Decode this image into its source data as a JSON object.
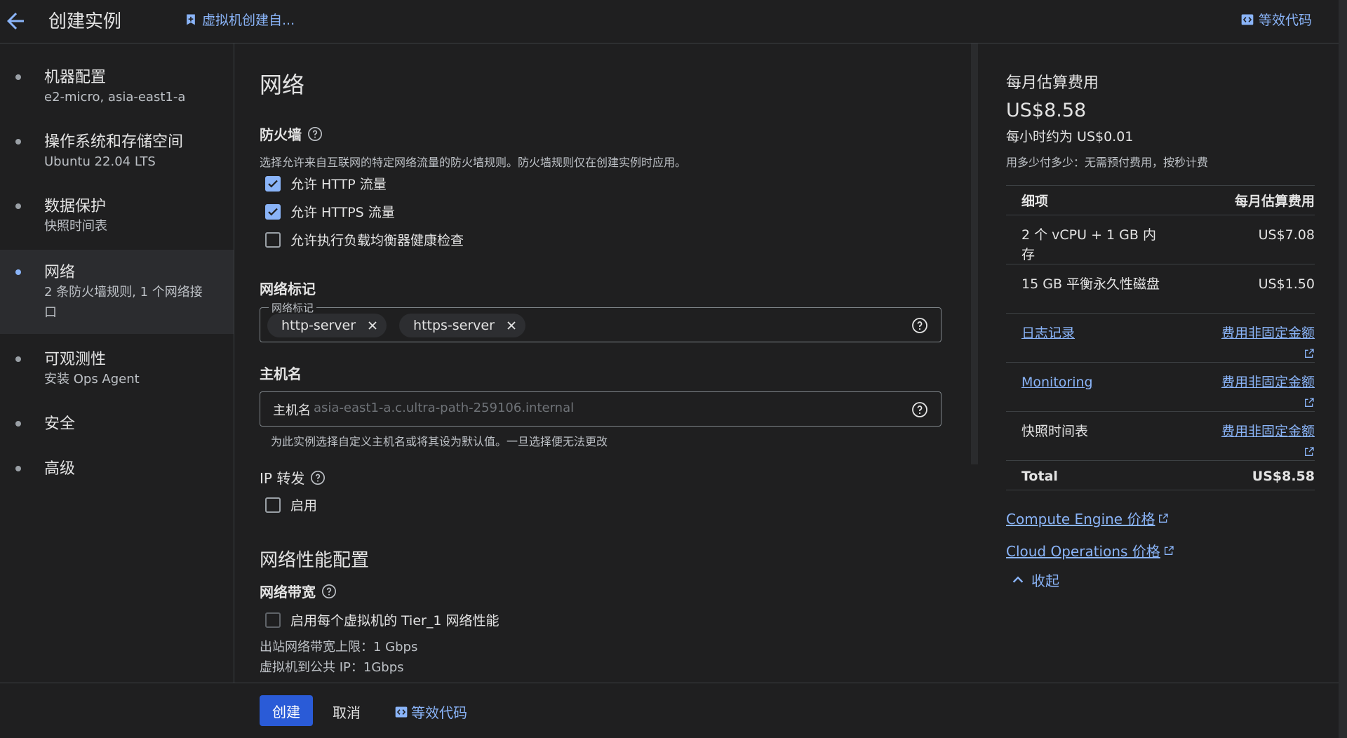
{
  "header": {
    "title": "创建实例",
    "vm_link": "虚拟机创建自...",
    "equiv_code": "等效代码"
  },
  "sidebar": {
    "items": [
      {
        "label": "机器配置",
        "sub": "e2-micro, asia-east1-a"
      },
      {
        "label": "操作系统和存储空间",
        "sub": "Ubuntu 22.04 LTS"
      },
      {
        "label": "数据保护",
        "sub": "快照时间表"
      },
      {
        "label": "网络",
        "sub": "2 条防火墙规则, 1 个网络接口",
        "active": true
      },
      {
        "label": "可观测性",
        "sub": "安装 Ops Agent"
      },
      {
        "label": "安全",
        "sub": ""
      },
      {
        "label": "高级",
        "sub": ""
      }
    ]
  },
  "network": {
    "title": "网络",
    "firewall": {
      "title": "防火墙",
      "desc": "选择允许来自互联网的特定网络流量的防火墙规则。防火墙规则仅在创建实例时应用。",
      "options": [
        {
          "label": "允许 HTTP 流量",
          "checked": true
        },
        {
          "label": "允许 HTTPS 流量",
          "checked": true
        },
        {
          "label": "允许执行负载均衡器健康检查",
          "checked": false
        }
      ]
    },
    "tags": {
      "title": "网络标记",
      "legend": "网络标记",
      "chips": [
        "http-server",
        "https-server"
      ]
    },
    "hostname": {
      "title": "主机名",
      "label": "主机名",
      "placeholder": "asia-east1-a.c.ultra-path-259106.internal",
      "hint": "为此实例选择自定义主机名或将其设为默认值。一旦选择便无法更改"
    },
    "ip_forwarding": {
      "title": "IP 转发",
      "option": "启用"
    },
    "performance": {
      "title": "网络性能配置",
      "bandwidth_title": "网络带宽",
      "option": "启用每个虚拟机的 Tier_1 网络性能",
      "egress": "出站网络带宽上限：1 Gbps",
      "public_ip": "虚拟机到公共 IP：1Gbps"
    }
  },
  "footer": {
    "create": "创建",
    "cancel": "取消",
    "equiv_code": "等效代码"
  },
  "cost": {
    "title": "每月估算费用",
    "amount": "US$8.58",
    "hourly": "每小时约为 US$0.01",
    "note": "用多少付多少：无需预付费用，按秒计费",
    "header": {
      "item": "细项",
      "price": "每月估算费用"
    },
    "rows": [
      {
        "item": "2 个 vCPU + 1 GB 内存",
        "price": "US$7.08",
        "item_link": false,
        "price_link": false
      },
      {
        "item": "15 GB 平衡永久性磁盘",
        "price": "US$1.50",
        "item_link": false,
        "price_link": false
      },
      {
        "item": "日志记录",
        "price": "费用非固定金额",
        "item_link": true,
        "price_link": true
      },
      {
        "item": "Monitoring",
        "price": "费用非固定金额",
        "item_link": true,
        "price_link": true
      },
      {
        "item": "快照时间表",
        "price": "费用非固定金额",
        "item_link": false,
        "price_link": true
      }
    ],
    "total": {
      "label": "Total",
      "value": "US$8.58"
    },
    "links": [
      "Compute Engine 价格",
      "Cloud Operations 价格"
    ],
    "collapse": "收起"
  },
  "colors": {
    "background": "#1f1f20",
    "accent": "#8ab4f8",
    "primary_button": "#2a5bd7"
  }
}
